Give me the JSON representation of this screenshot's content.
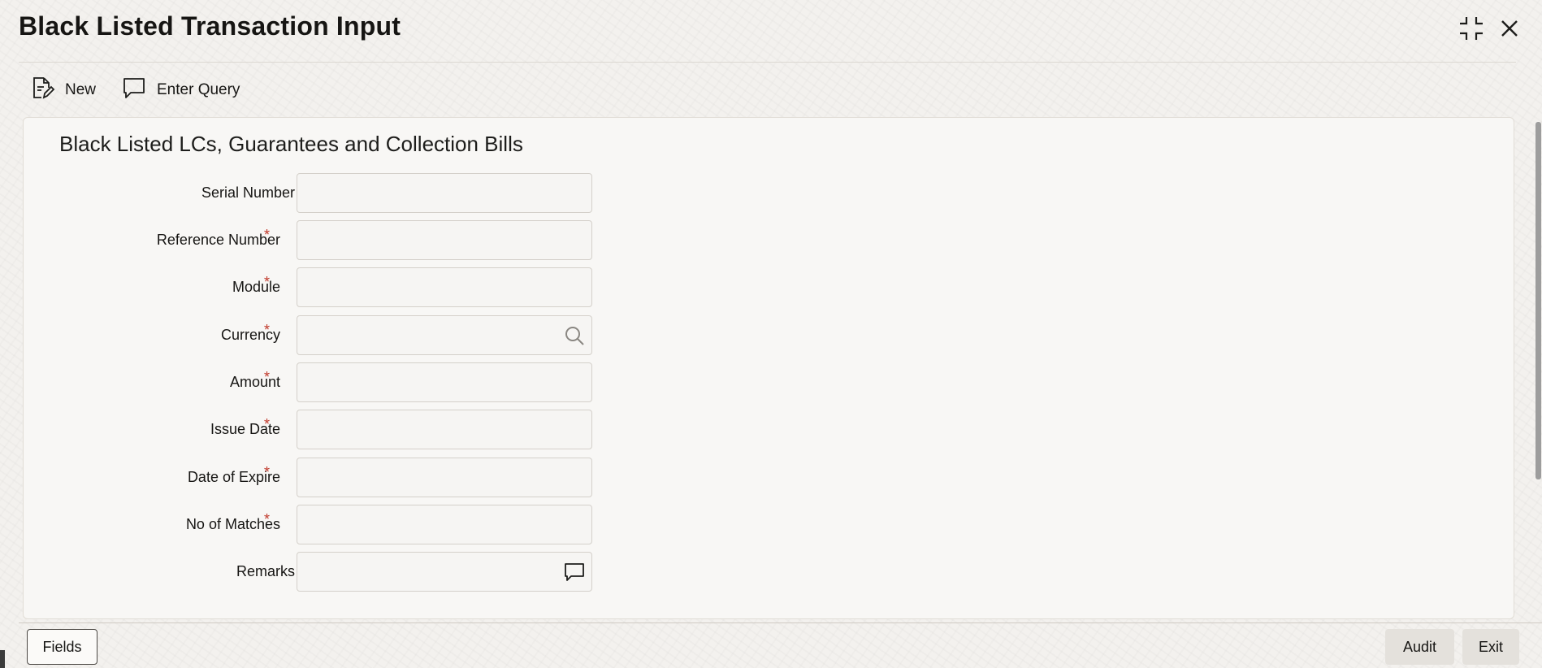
{
  "window": {
    "title": "Black Listed Transaction Input",
    "minimize_icon": "minimize-icon",
    "close_icon": "close-icon"
  },
  "toolbar": {
    "new_label": "New",
    "new_icon": "new-document-icon",
    "enter_query_label": "Enter Query",
    "enter_query_icon": "comment-icon"
  },
  "section": {
    "title": "Black Listed LCs, Guarantees and Collection Bills"
  },
  "form": {
    "fields": [
      {
        "label": "Serial Number",
        "required": false,
        "value": ""
      },
      {
        "label": "Reference Number",
        "required": true,
        "value": ""
      },
      {
        "label": "Module",
        "required": true,
        "value": ""
      },
      {
        "label": "Currency",
        "required": true,
        "value": "",
        "icon": "search-icon"
      },
      {
        "label": "Amount",
        "required": true,
        "value": ""
      },
      {
        "label": "Issue Date",
        "required": true,
        "value": ""
      },
      {
        "label": "Date of Expire",
        "required": true,
        "value": ""
      },
      {
        "label": "No of Matches",
        "required": true,
        "value": ""
      },
      {
        "label": "Remarks",
        "required": false,
        "value": "",
        "icon": "comment-icon"
      }
    ],
    "required_marker": "*"
  },
  "footer": {
    "fields_label": "Fields",
    "audit_label": "Audit",
    "exit_label": "Exit"
  }
}
